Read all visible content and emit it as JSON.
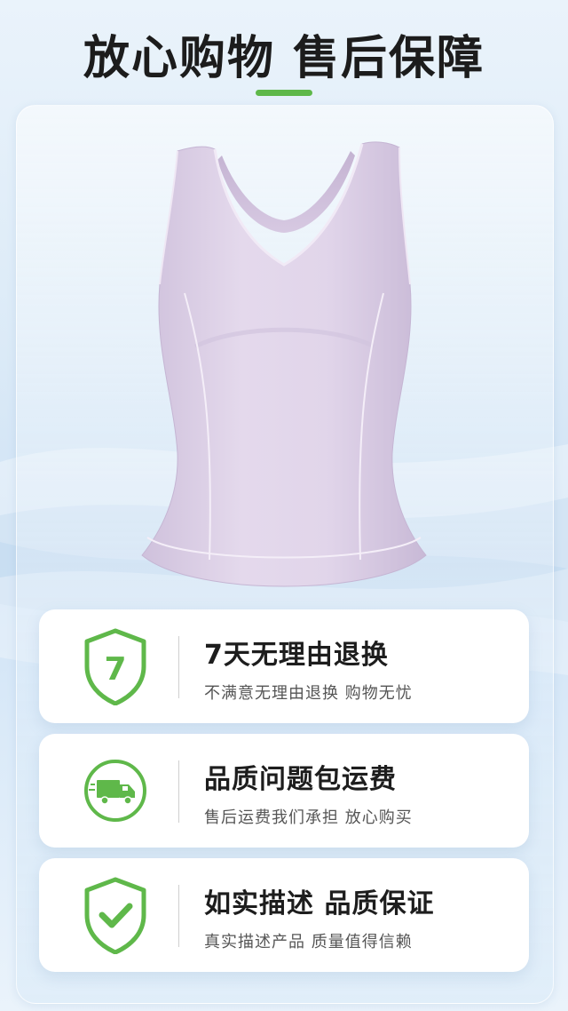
{
  "header": {
    "title": "放心购物 售后保障"
  },
  "product": {
    "image": "lavender-racerback-tank-top"
  },
  "guarantees": [
    {
      "icon": "shield-seven-icon",
      "icon_text": "7",
      "title": "7天无理由退换",
      "subtitle": "不满意无理由退换 购物无忧"
    },
    {
      "icon": "delivery-truck-icon",
      "title": "品质问题包运费",
      "subtitle": "售后运费我们承担 放心购买"
    },
    {
      "icon": "shield-check-icon",
      "title": "如实描述 品质保证",
      "subtitle": "真实描述产品 质量值得信赖"
    }
  ],
  "colors": {
    "accent_green": "#5fb84a",
    "title_text": "#1c1c1c",
    "subtitle_text": "#555555",
    "card_background": "#ffffff",
    "product_color": "#dcd0e6"
  }
}
